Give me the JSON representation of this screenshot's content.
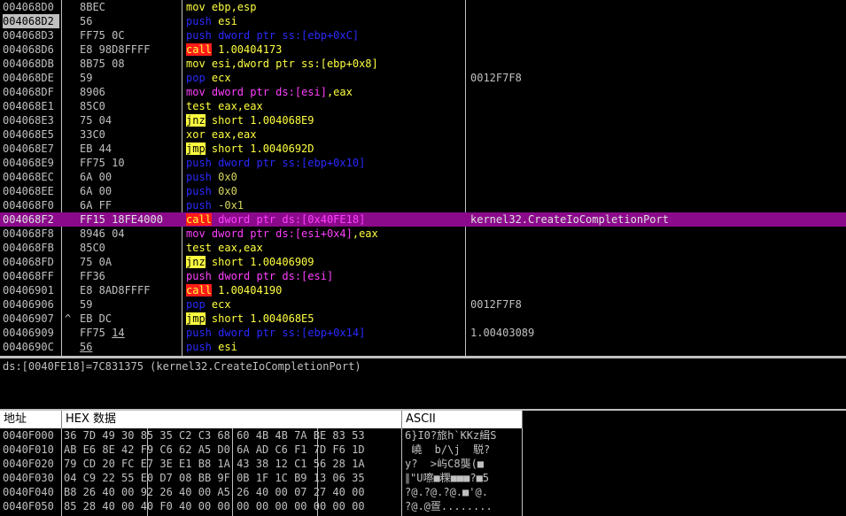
{
  "disasm": {
    "rows": [
      {
        "addr": "004068D0",
        "mark": "",
        "hex": "8BEC",
        "asm": [
          {
            "t": "mov ebp,esp",
            "c": "tw"
          }
        ],
        "cmt": ""
      },
      {
        "addr": "004068D2",
        "mark": "",
        "hex": "56",
        "asm": [
          {
            "t": "push ",
            "c": "tb"
          },
          {
            "t": "esi",
            "c": "tw"
          }
        ],
        "cmt": "",
        "cur": true
      },
      {
        "addr": "004068D3",
        "mark": "",
        "hex": "FF75 0C",
        "asm": [
          {
            "t": "push ",
            "c": "tb"
          },
          {
            "t": "dword ptr ss:[ebp+0xC]",
            "c": "tb"
          }
        ],
        "cmt": ""
      },
      {
        "addr": "004068D6",
        "mark": "",
        "hex": "E8 98D8FFFF",
        "asm": [
          {
            "t": "call",
            "c": "bcall"
          },
          {
            "t": " 1.00404173",
            "c": "tw"
          }
        ],
        "cmt": ""
      },
      {
        "addr": "004068DB",
        "mark": "",
        "hex": "8B75 08",
        "asm": [
          {
            "t": "mov esi,dword ptr ss:[ebp+0x8]",
            "c": "tw"
          }
        ],
        "cmt": ""
      },
      {
        "addr": "004068DE",
        "mark": "",
        "hex": "59",
        "asm": [
          {
            "t": "pop ",
            "c": "tb"
          },
          {
            "t": "ecx",
            "c": "tw"
          }
        ],
        "cmt": "0012F7F8"
      },
      {
        "addr": "004068DF",
        "mark": "",
        "hex": "8906",
        "asm": [
          {
            "t": "mov ",
            "c": "tm"
          },
          {
            "t": "dword ptr ds:[esi]",
            "c": "tm"
          },
          {
            "t": ",eax",
            "c": "tw"
          }
        ],
        "cmt": ""
      },
      {
        "addr": "004068E1",
        "mark": "",
        "hex": "85C0",
        "asm": [
          {
            "t": "test eax,eax",
            "c": "tw"
          }
        ],
        "cmt": ""
      },
      {
        "addr": "004068E3",
        "mark": "",
        "hex": "75 04",
        "asm": [
          {
            "t": "jnz",
            "c": "bjmp"
          },
          {
            "t": " short 1.004068E9",
            "c": "tw"
          }
        ],
        "cmt": ""
      },
      {
        "addr": "004068E5",
        "mark": "",
        "hex": "33C0",
        "asm": [
          {
            "t": "xor eax,eax",
            "c": "tw"
          }
        ],
        "cmt": ""
      },
      {
        "addr": "004068E7",
        "mark": "",
        "hex": "EB 44",
        "asm": [
          {
            "t": "jmp",
            "c": "bjmp"
          },
          {
            "t": " short 1.0040692D",
            "c": "tw"
          }
        ],
        "cmt": ""
      },
      {
        "addr": "004068E9",
        "mark": "",
        "hex": "FF75 10",
        "asm": [
          {
            "t": "push dword ptr ss:[ebp+0x10]",
            "c": "tb"
          }
        ],
        "cmt": ""
      },
      {
        "addr": "004068EC",
        "mark": "",
        "hex": "6A 00",
        "asm": [
          {
            "t": "push ",
            "c": "tb"
          },
          {
            "t": "0x0",
            "c": "ty"
          }
        ],
        "cmt": ""
      },
      {
        "addr": "004068EE",
        "mark": "",
        "hex": "6A 00",
        "asm": [
          {
            "t": "push ",
            "c": "tb"
          },
          {
            "t": "0x0",
            "c": "ty"
          }
        ],
        "cmt": ""
      },
      {
        "addr": "004068F0",
        "mark": "",
        "hex": "6A FF",
        "asm": [
          {
            "t": "push ",
            "c": "tb"
          },
          {
            "t": "-0x1",
            "c": "ty"
          }
        ],
        "cmt": ""
      },
      {
        "addr": "004068F2",
        "mark": "",
        "hex": "FF15 18FE4000",
        "asm": [
          {
            "t": "call",
            "c": "bcall"
          },
          {
            "t": " dword ptr ds:[0x40FE18]",
            "c": "tm"
          }
        ],
        "cmt": "kernel32.CreateIoCompletionPort",
        "sel": true
      },
      {
        "addr": "004068F8",
        "mark": "",
        "hex": "8946 04",
        "asm": [
          {
            "t": "mov ",
            "c": "tm"
          },
          {
            "t": "dword ptr ds:[esi+0x4]",
            "c": "tm"
          },
          {
            "t": ",eax",
            "c": "tw"
          }
        ],
        "cmt": ""
      },
      {
        "addr": "004068FB",
        "mark": "",
        "hex": "85C0",
        "asm": [
          {
            "t": "test eax,eax",
            "c": "tw"
          }
        ],
        "cmt": ""
      },
      {
        "addr": "004068FD",
        "mark": "",
        "hex": "75 0A",
        "asm": [
          {
            "t": "jnz",
            "c": "bjmp"
          },
          {
            "t": " short 1.00406909",
            "c": "tw"
          }
        ],
        "cmt": ""
      },
      {
        "addr": "004068FF",
        "mark": "",
        "hex": "FF36",
        "asm": [
          {
            "t": "push ",
            "c": "tm"
          },
          {
            "t": "dword ptr ds:[esi]",
            "c": "tm"
          }
        ],
        "cmt": ""
      },
      {
        "addr": "00406901",
        "mark": "",
        "hex": "E8 8AD8FFFF",
        "asm": [
          {
            "t": "call",
            "c": "bcall"
          },
          {
            "t": " 1.00404190",
            "c": "tw"
          }
        ],
        "cmt": ""
      },
      {
        "addr": "00406906",
        "mark": "",
        "hex": "59",
        "asm": [
          {
            "t": "pop ",
            "c": "tb"
          },
          {
            "t": "ecx",
            "c": "tw"
          }
        ],
        "cmt": "0012F7F8"
      },
      {
        "addr": "00406907",
        "mark": "^",
        "hex": "EB DC",
        "asm": [
          {
            "t": "jmp",
            "c": "bjmp"
          },
          {
            "t": " short 1.004068E5",
            "c": "tw"
          }
        ],
        "cmt": ""
      },
      {
        "addr": "00406909",
        "mark": "",
        "hex": "FF75 14",
        "hexul": "14",
        "asm": [
          {
            "t": "push dword ptr ss:[ebp+0x14]",
            "c": "tb"
          }
        ],
        "cmt": "1.00403089"
      },
      {
        "addr": "0040690C",
        "mark": "",
        "hex": "56",
        "hexul": "56",
        "asm": [
          {
            "t": "push ",
            "c": "tb"
          },
          {
            "t": "esi",
            "c": "tw"
          }
        ],
        "cmt": ""
      }
    ]
  },
  "info": {
    "line": "ds:[0040FE18]=7C831375 (kernel32.CreateIoCompletionPort)"
  },
  "dump": {
    "headers": {
      "addr": "地址",
      "hex": "HEX 数据",
      "ascii": "ASCII"
    },
    "rows": [
      {
        "addr": "0040F000",
        "hex": "36 7D 49 30 85 35 C2 C3 68 60 4B 4B 7A BE 83 53",
        "ascii": "6}I0?旅h`KKz緝S"
      },
      {
        "addr": "0040F010",
        "hex": "AB E6 8E 42 F9 C6 62 A5 D0 6A AD C6 F1 7D F6 1D",
        "ascii": " 嶢  b/\\j  駾?"
      },
      {
        "addr": "0040F020",
        "hex": "79 CD 20 FC E7 3E E1 B8 1A 43 38 12 C1 56 28 1A",
        "ascii": "y?  >屿C8龑(■"
      },
      {
        "addr": "0040F030",
        "hex": "04 C9 22 55 E0 D7 08 BB 9F 0B 1F 1C B9 13 06 35",
        "ascii": "∥\"U嚓■粿■■■?■5"
      },
      {
        "addr": "0040F040",
        "hex": "B8 26 40 00 92 26 40 00 A5 26 40 00 07 27 40 00",
        "ascii": "?@.?@.?@.■'@."
      },
      {
        "addr": "0040F050",
        "hex": "85 28 40 00 40 F0 40 00 00 00 00 00 00 00 00 00",
        "ascii": "?@.@疍........"
      }
    ]
  }
}
